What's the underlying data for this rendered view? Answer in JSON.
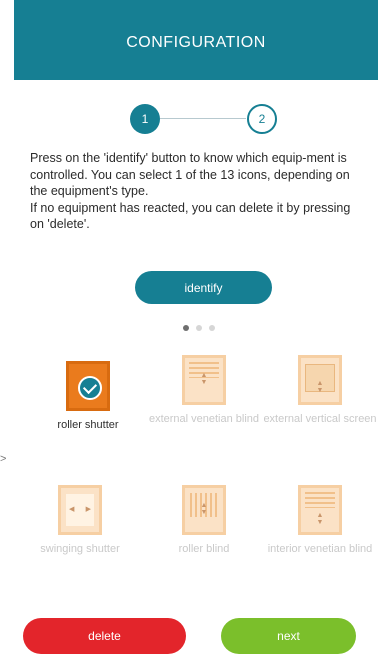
{
  "header": {
    "title": "CONFIGURATION"
  },
  "steps": {
    "step1": "1",
    "step2": "2"
  },
  "instructions": {
    "line1": "Press on the 'identify' button to know which equip-ment is controlled. You can select 1 of the 13 icons, depending on the equipment's type.",
    "line2": "If no equipment has reacted, you can delete it by pressing on 'delete'."
  },
  "identify_label": "identify",
  "equipment": [
    {
      "label": "roller shutter",
      "selected": true
    },
    {
      "label": "external venetian blind",
      "selected": false
    },
    {
      "label": "external vertical screen",
      "selected": false
    },
    {
      "label": "swinging shutter",
      "selected": false
    },
    {
      "label": "roller blind",
      "selected": false
    },
    {
      "label": "interior venetian blind",
      "selected": false
    }
  ],
  "footer": {
    "delete_label": "delete",
    "next_label": "next"
  },
  "colors": {
    "teal": "#167f93",
    "orange": "#ea7b1d",
    "peach": "#fbe2c6",
    "red": "#e3252b",
    "green": "#7bbf2b"
  }
}
